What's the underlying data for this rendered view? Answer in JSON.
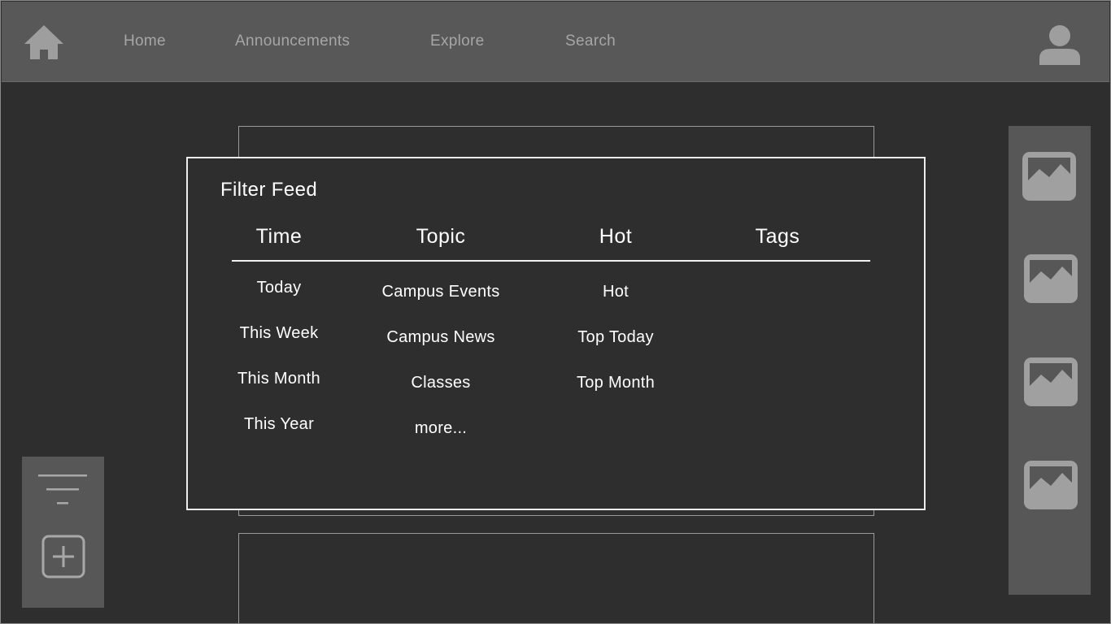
{
  "nav": {
    "links": [
      {
        "label": "Home"
      },
      {
        "label": "Announcements"
      },
      {
        "label": "Explore"
      },
      {
        "label": "Search"
      }
    ],
    "home_icon": "home-icon",
    "profile_icon": "user-icon"
  },
  "filter_modal": {
    "title": "Filter Feed",
    "columns": [
      {
        "header": "Time",
        "options": [
          "Today",
          "This Week",
          "This Month",
          "This Year"
        ]
      },
      {
        "header": "Topic",
        "options": [
          "Campus Events",
          "Campus News",
          "Classes",
          "more..."
        ]
      },
      {
        "header": "Hot",
        "options": [
          "Hot",
          "Top Today",
          "Top Month"
        ]
      },
      {
        "header": "Tags",
        "options": []
      }
    ]
  },
  "tools": {
    "filter_icon": "filter-icon",
    "add_icon": "add-post-icon"
  },
  "images": {
    "icon": "image-icon",
    "count": 4
  },
  "colors": {
    "background": "#2e2e2e",
    "topbar": "#585858",
    "panel": "#575757",
    "nav_text": "#a6a6a6",
    "icon": "#9e9e9e",
    "modal_border": "#ececec",
    "text": "#ffffff"
  }
}
